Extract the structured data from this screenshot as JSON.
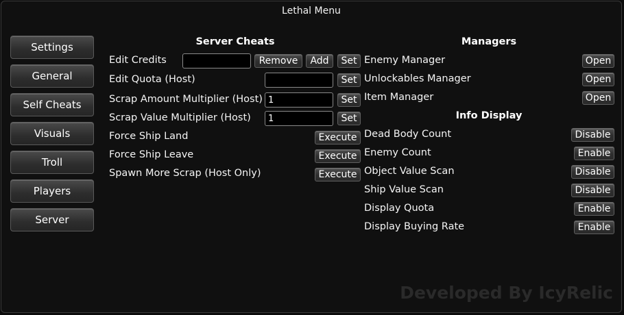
{
  "window": {
    "title": "Lethal Menu"
  },
  "sidebar": {
    "items": [
      {
        "label": "Settings"
      },
      {
        "label": "General"
      },
      {
        "label": "Self Cheats"
      },
      {
        "label": "Visuals"
      },
      {
        "label": "Troll"
      },
      {
        "label": "Players"
      },
      {
        "label": "Server"
      }
    ]
  },
  "server_cheats": {
    "header": "Server Cheats",
    "edit_credits": {
      "label": "Edit Credits",
      "value": "",
      "remove": "Remove",
      "add": "Add",
      "set": "Set"
    },
    "edit_quota": {
      "label": "Edit Quota (Host)",
      "value": "",
      "set": "Set"
    },
    "scrap_amount": {
      "label": "Scrap Amount Multiplier (Host)",
      "value": "1",
      "set": "Set"
    },
    "scrap_value": {
      "label": "Scrap Value Multiplier (Host)",
      "value": "1",
      "set": "Set"
    },
    "force_land": {
      "label": "Force Ship Land",
      "button": "Execute"
    },
    "force_leave": {
      "label": "Force Ship Leave",
      "button": "Execute"
    },
    "spawn_scrap": {
      "label": "Spawn More Scrap (Host Only)",
      "button": "Execute"
    }
  },
  "managers": {
    "header": "Managers",
    "items": [
      {
        "label": "Enemy Manager",
        "button": "Open"
      },
      {
        "label": "Unlockables Manager",
        "button": "Open"
      },
      {
        "label": "Item Manager",
        "button": "Open"
      }
    ]
  },
  "info_display": {
    "header": "Info Display",
    "items": [
      {
        "label": "Dead Body Count",
        "button": "Disable"
      },
      {
        "label": "Enemy Count",
        "button": "Enable"
      },
      {
        "label": "Object Value Scan",
        "button": "Disable"
      },
      {
        "label": "Ship Value Scan",
        "button": "Disable"
      },
      {
        "label": "Display Quota",
        "button": "Enable"
      },
      {
        "label": "Display Buying Rate",
        "button": "Enable"
      }
    ]
  },
  "footer": {
    "credit": "Developed By IcyRelic"
  }
}
